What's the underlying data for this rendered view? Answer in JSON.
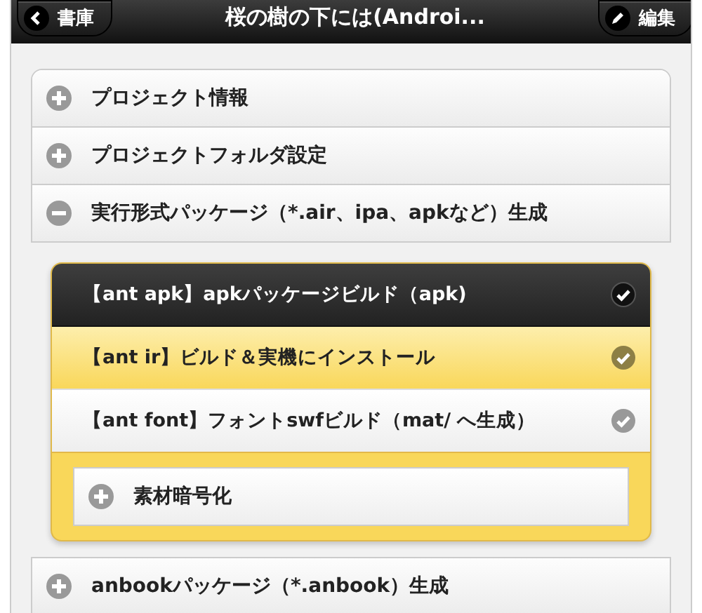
{
  "header": {
    "back_button": "書庫",
    "title": "桜の樹の下には(Androi...",
    "edit_button": "編集"
  },
  "sections": [
    {
      "title": "プロジェクト情報",
      "expanded": false
    },
    {
      "title": "プロジェクトフォルダ設定",
      "expanded": false
    },
    {
      "title": "実行形式パッケージ（*.air、ipa、apkなど）生成",
      "expanded": true,
      "content": {
        "tasks": [
          {
            "label": "【ant apk】apkパッケージビルド（apk)",
            "kind": "dark"
          },
          {
            "label": "【ant ir】ビルド＆実機にインストール",
            "kind": "highlighted"
          },
          {
            "label": "【ant font】フォントswfビルド（mat/ へ生成）",
            "kind": "plain"
          }
        ],
        "subsection": {
          "title": "素材暗号化",
          "expanded": false
        }
      }
    },
    {
      "title": "anbookパッケージ（*.anbook）生成",
      "expanded": false
    }
  ]
}
